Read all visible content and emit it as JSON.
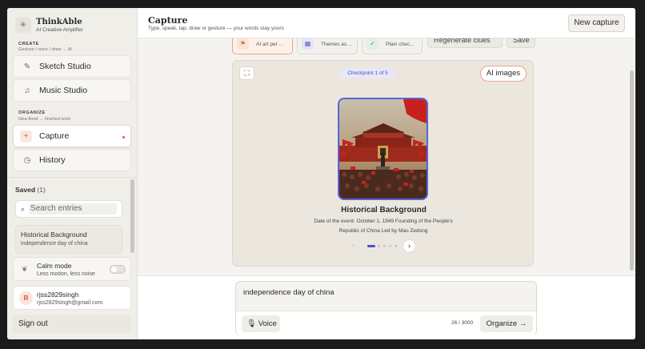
{
  "brand": {
    "name": "ThinkAble",
    "tagline": "AI Creative Amplifier"
  },
  "sidebar": {
    "create": {
      "title": "CREATE",
      "subtitle": "Gesture / voice / draw → AI",
      "items": [
        {
          "label": "Sketch Studio",
          "icon": "pencil-icon"
        },
        {
          "label": "Music Studio",
          "icon": "music-note-icon"
        }
      ]
    },
    "organize": {
      "title": "ORGANIZE",
      "subtitle": "Idea-flood → finished work",
      "items": [
        {
          "label": "Capture",
          "icon": "plus-icon",
          "active": true
        },
        {
          "label": "History",
          "icon": "clock-icon"
        }
      ]
    },
    "saved": {
      "title": "Saved",
      "count": "(1)"
    },
    "search": {
      "placeholder": "Search entries"
    },
    "entries": [
      {
        "title": "Historical Background",
        "subtitle": "independence day of china"
      }
    ],
    "calm_mode": {
      "title": "Calm mode",
      "subtitle": "Less motion, less noise",
      "enabled": false
    },
    "user": {
      "initial": "R",
      "name": "rjss2829singh",
      "email": "rjss2829singh@gmail.com"
    },
    "signout": "Sign out"
  },
  "header": {
    "title": "Capture",
    "subtitle": "Type, speak, tap, draw or gesture — your words stay yours",
    "new_button": "New capture"
  },
  "options": [
    {
      "label": "AI art per ...",
      "icon": "flag-icon",
      "active": true
    },
    {
      "label": "Themes as ...",
      "icon": "grid-icon",
      "active": false
    },
    {
      "label": "Plain chec...",
      "icon": "check-icon",
      "active": false
    }
  ],
  "option_buttons": [
    "Regenerate clues",
    "Save"
  ],
  "checkpoint": {
    "label": "Checkpoint 1 of 5",
    "ai_images_button": "AI images",
    "title": "Historical Background",
    "description": "Date of the event: October 1, 1949 Founding of the People's Republic of China Led by Mao Zedong",
    "current": 1,
    "total": 5
  },
  "composer": {
    "text": "independence day of china",
    "voice_label": "Voice",
    "char_count": "26 / 3000",
    "organize_label": "Organize"
  },
  "colors": {
    "accent_indigo": "#4a52c8",
    "accent_coral": "#e0563c",
    "background": "#f5f3ef"
  }
}
